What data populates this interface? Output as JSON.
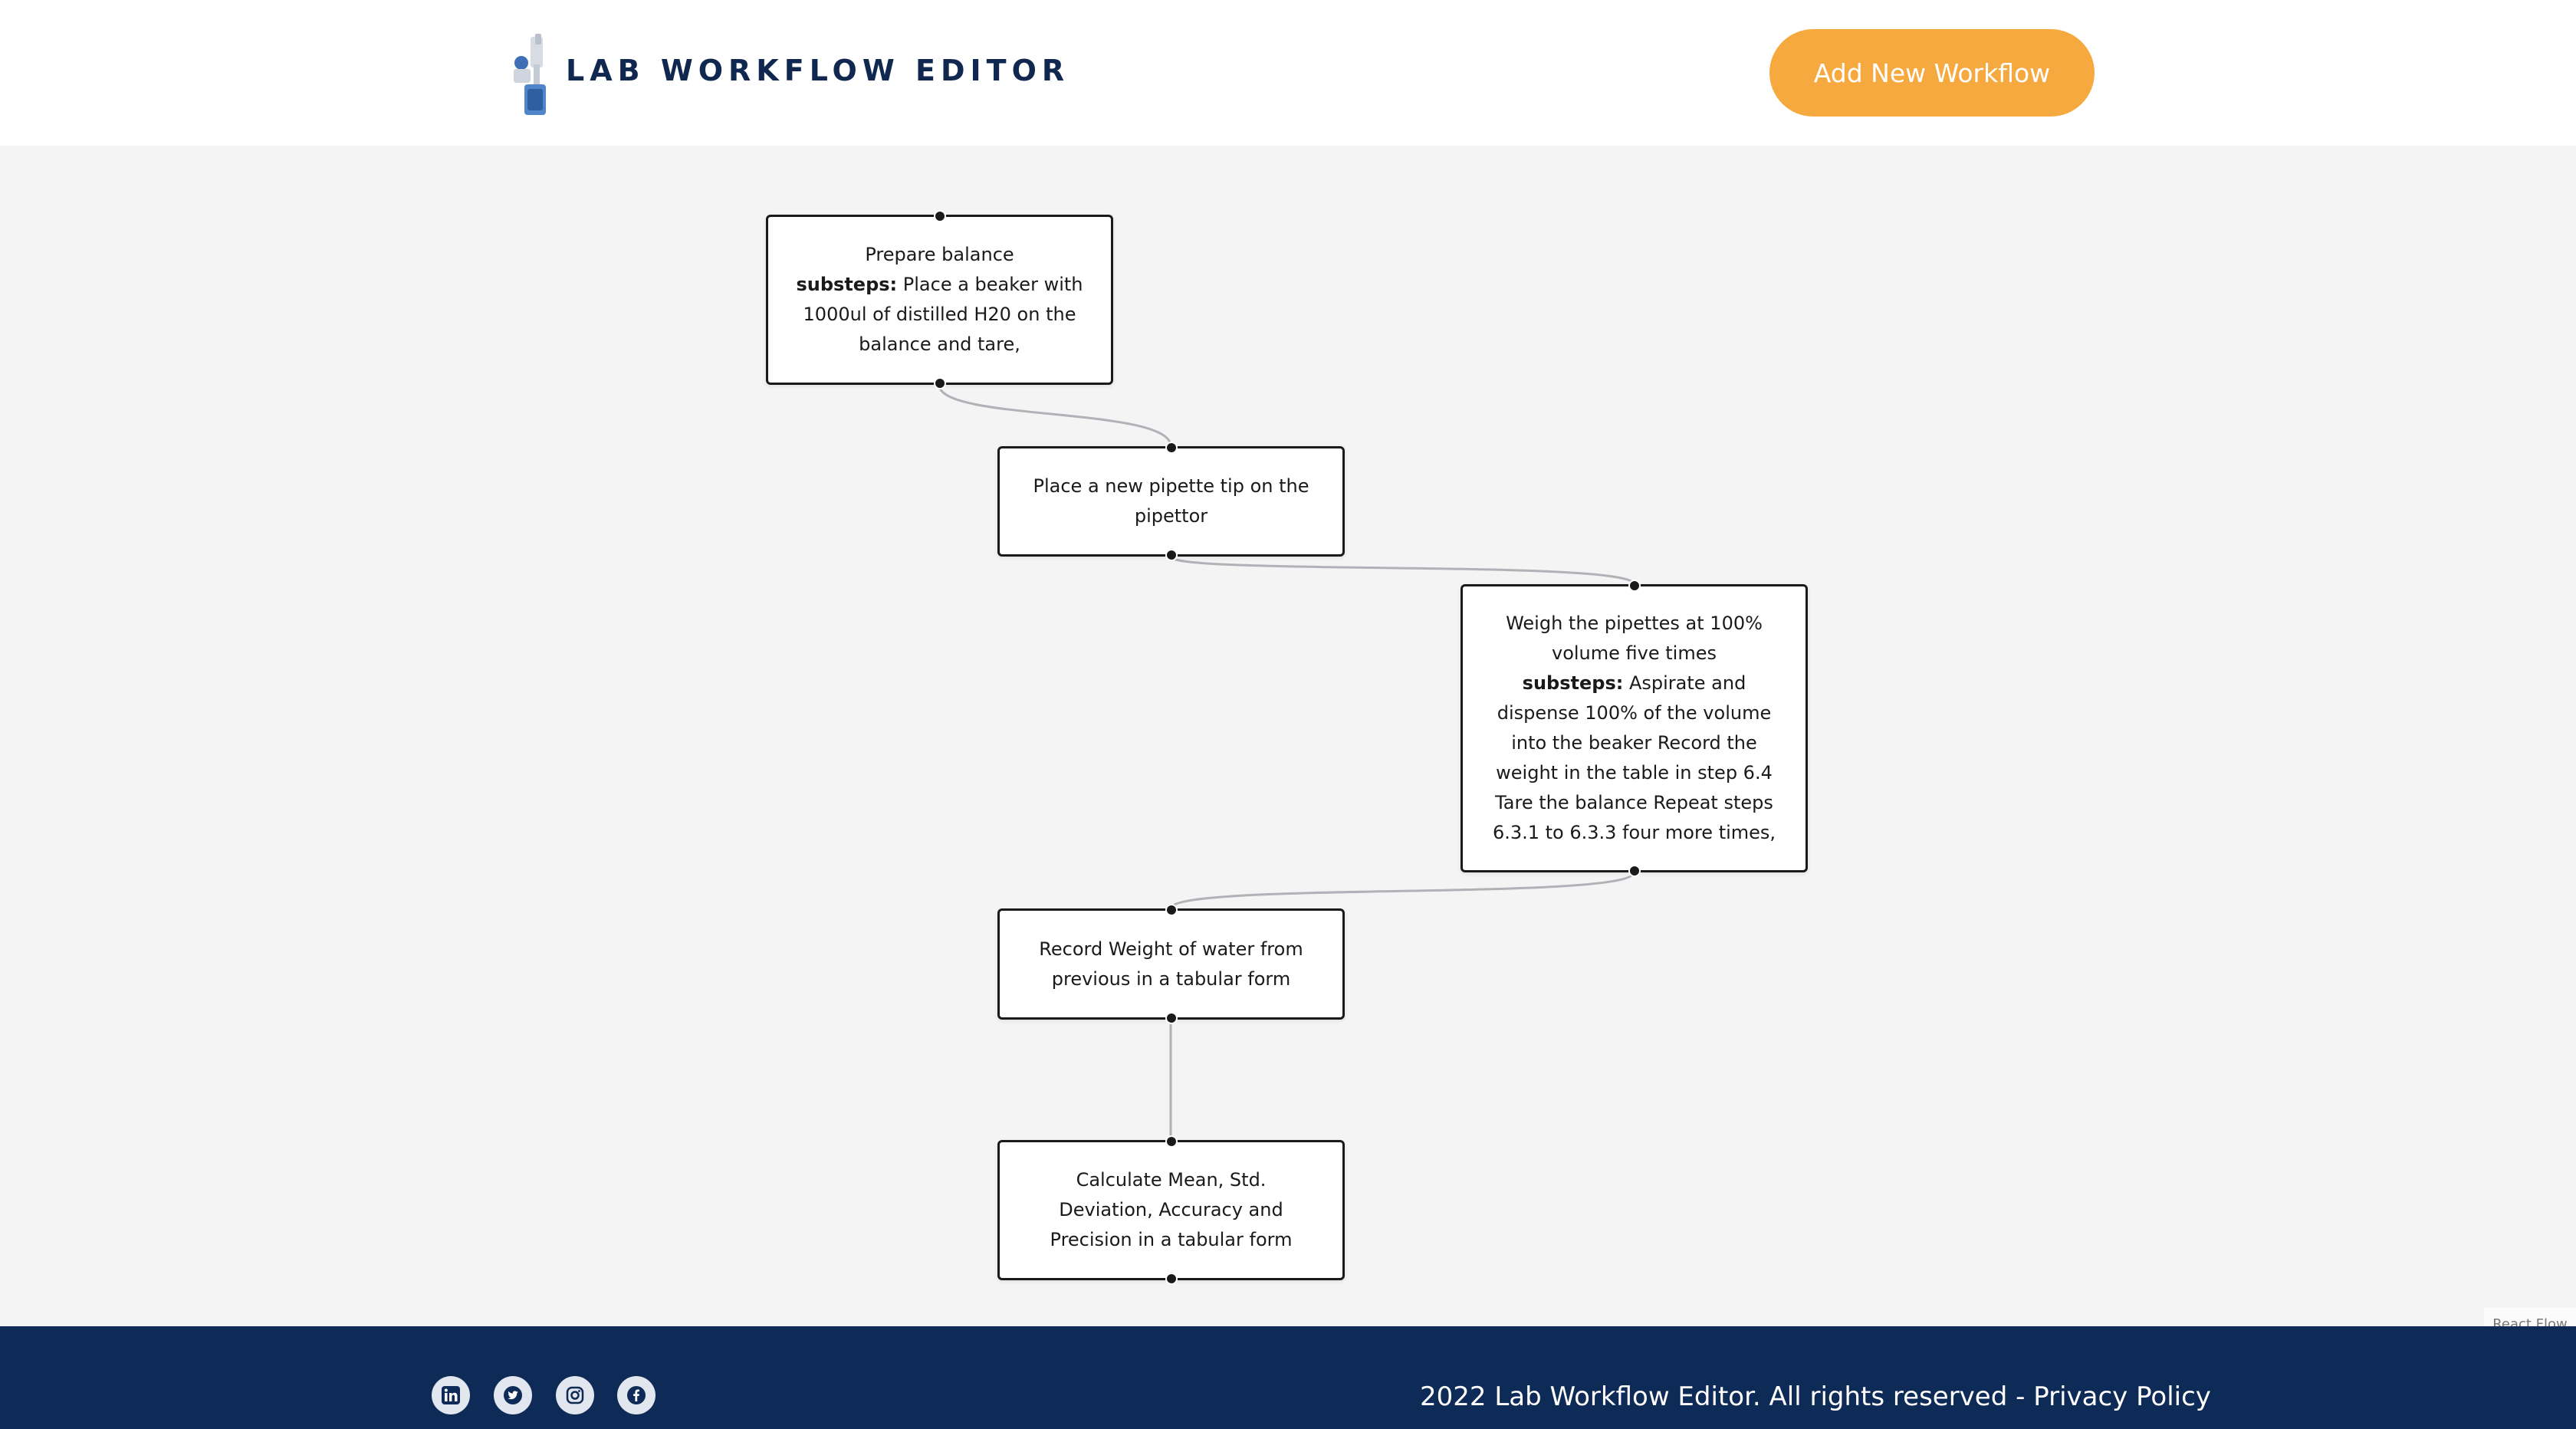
{
  "header": {
    "brand": "LAB WORKFLOW EDITOR",
    "add_button": "Add New Workflow"
  },
  "workflow": {
    "nodes": [
      {
        "title": "Prepare balance",
        "substeps_label": "substeps:",
        "substeps": " Place a beaker with 1000ul of distilled H20 on the balance and tare,"
      },
      {
        "title": "Place a new pipette tip on the pipettor"
      },
      {
        "title": "Weigh the pipettes at 100% volume five times",
        "substeps_label": "substeps:",
        "substeps": " Aspirate and dispense 100% of the volume into the beaker Record the weight in the table in step 6.4 Tare the balance Repeat steps 6.3.1 to 6.3.3 four more times,"
      },
      {
        "title": "Record Weight of water from previous in a tabular form"
      },
      {
        "title": "Calculate Mean, Std. Deviation, Accuracy and Precision in a tabular form"
      }
    ]
  },
  "attribution": "React Flow",
  "footer": {
    "social": [
      "linkedin-icon",
      "twitter-icon",
      "instagram-icon",
      "facebook-icon"
    ],
    "copyright": "2022 Lab Workflow Editor. All rights reserved - ",
    "privacy_link": "Privacy Policy"
  },
  "colors": {
    "brand": "#10284f",
    "accent": "#f5a93f",
    "footer_bg": "#0e2a57",
    "canvas_bg": "#f4f4f4"
  }
}
